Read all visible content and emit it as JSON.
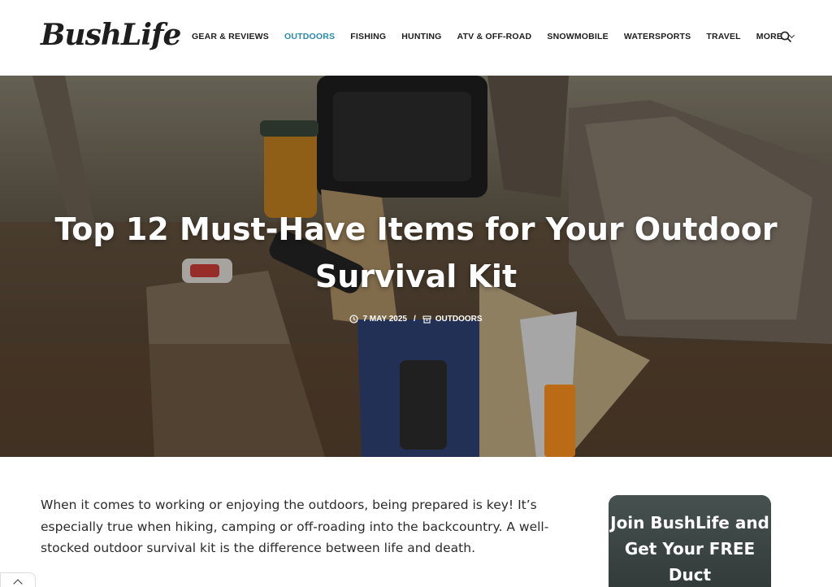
{
  "site": {
    "logo": "BushLife"
  },
  "nav": {
    "items": [
      {
        "label": "GEAR & REVIEWS",
        "active": false
      },
      {
        "label": "OUTDOORS",
        "active": true
      },
      {
        "label": "FISHING",
        "active": false
      },
      {
        "label": "HUNTING",
        "active": false
      },
      {
        "label": "ATV & OFF-ROAD",
        "active": false
      },
      {
        "label": "SNOWMOBILE",
        "active": false
      },
      {
        "label": "WATERSPORTS",
        "active": false
      },
      {
        "label": "TRAVEL",
        "active": false
      }
    ],
    "more_label": "MORE",
    "search_icon": "search-icon",
    "active_color": "#2a8aa8"
  },
  "article": {
    "title": "Top 12 Must-Have Items for Your Outdoor Survival Kit",
    "date": "7 MAY 2025",
    "separator": "/",
    "category": "OUTDOORS",
    "intro": "When it comes to working or enjoying the outdoors, being prepared is key! It’s especially true when hiking, camping or off-roading into the backcountry. A well-stocked outdoor survival kit is the difference between life and death."
  },
  "sidebar": {
    "signup_text": "Join BushLife and Get Your FREE Duct"
  },
  "back_to_top": {
    "icon": "chevron-up-icon"
  }
}
